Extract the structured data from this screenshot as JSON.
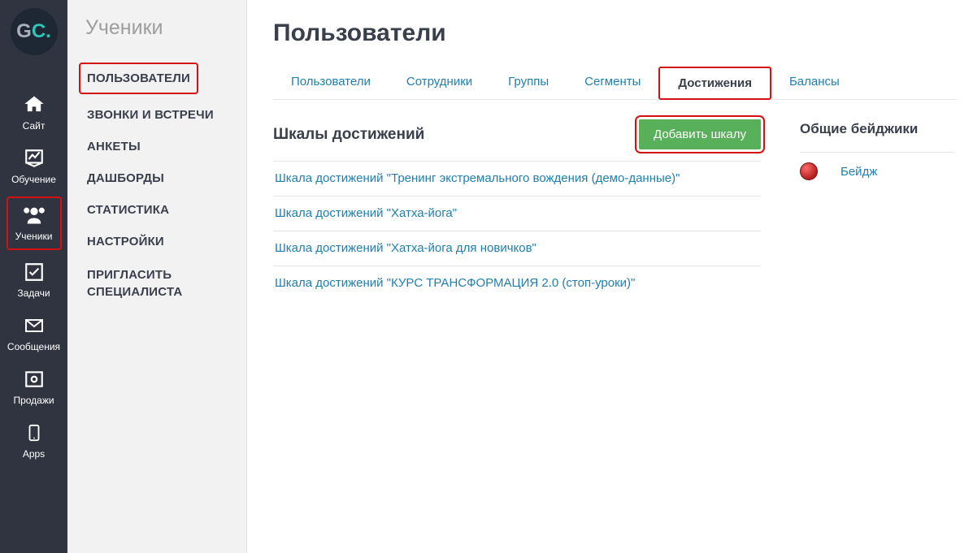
{
  "rail": {
    "logo_g": "G",
    "logo_c": "C.",
    "items": [
      {
        "id": "site",
        "label": "Сайт"
      },
      {
        "id": "learning",
        "label": "Обучение"
      },
      {
        "id": "students",
        "label": "Ученики"
      },
      {
        "id": "tasks",
        "label": "Задачи"
      },
      {
        "id": "messages",
        "label": "Сообщения"
      },
      {
        "id": "sales",
        "label": "Продажи"
      },
      {
        "id": "apps",
        "label": "Apps"
      }
    ]
  },
  "subside": {
    "title": "Ученики",
    "items": [
      {
        "label": "ПОЛЬЗОВАТЕЛИ"
      },
      {
        "label": "ЗВОНКИ И ВСТРЕЧИ"
      },
      {
        "label": "АНКЕТЫ"
      },
      {
        "label": "ДАШБОРДЫ"
      },
      {
        "label": "СТАТИСТИКА"
      },
      {
        "label": "НАСТРОЙКИ"
      },
      {
        "label": "ПРИГЛАСИТЬ СПЕЦИАЛИСТА"
      }
    ]
  },
  "main": {
    "title": "Пользователи",
    "tabs": [
      {
        "label": "Пользователи"
      },
      {
        "label": "Сотрудники"
      },
      {
        "label": "Группы"
      },
      {
        "label": "Сегменты"
      },
      {
        "label": "Достижения"
      },
      {
        "label": "Балансы"
      }
    ],
    "scales_heading": "Шкалы достижений",
    "add_button": "Добавить шкалу",
    "scales": [
      "Шкала достижений \"Тренинг экстремального вождения (демо-данные)\"",
      "Шкала достижений \"Хатха-йога\"",
      "Шкала достижений \"Хатха-йога для новичков\"",
      "Шкала достижений \"КУРС ТРАНСФОРМАЦИЯ 2.0 (стоп-уроки)\""
    ],
    "badges_heading": "Общие бейджики",
    "badges": [
      {
        "label": "Бейдж"
      }
    ]
  }
}
